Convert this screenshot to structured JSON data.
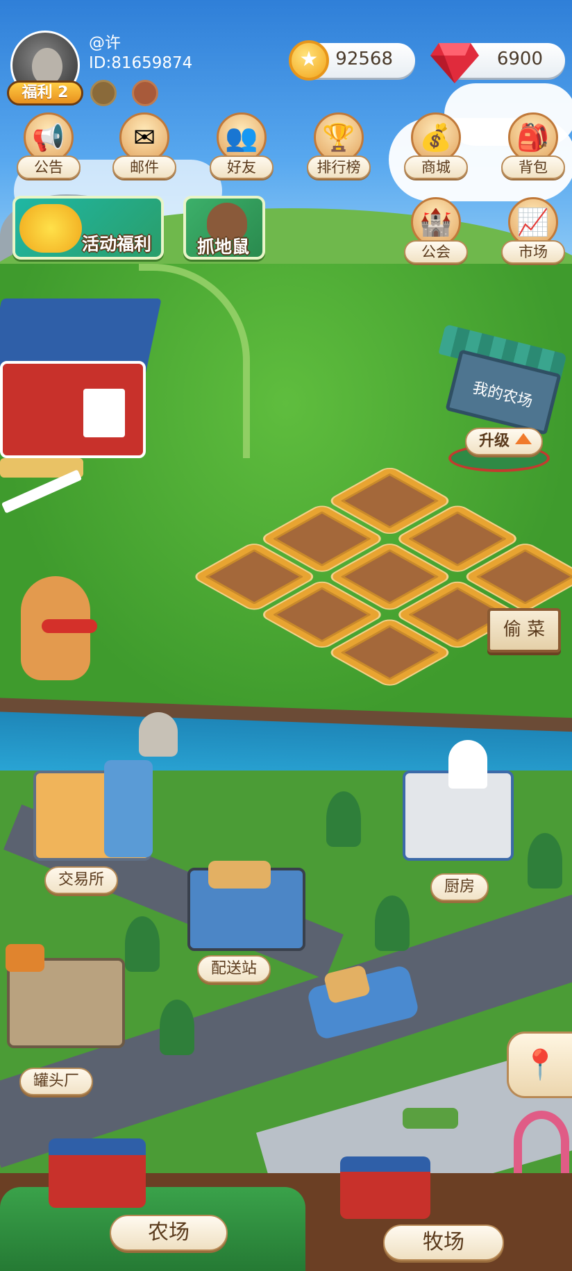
{
  "user": {
    "username": "@许",
    "id_text": "ID:81659874",
    "welfare_label": "福利 2"
  },
  "currency": {
    "coins": "92568",
    "gems": "6900",
    "coin_icon": "star-coin-icon",
    "gem_icon": "ruby-gem-icon"
  },
  "menu_top": [
    {
      "label": "公告",
      "icon": "megaphone-icon",
      "glyph": "📢"
    },
    {
      "label": "邮件",
      "icon": "mail-icon",
      "glyph": "✉"
    },
    {
      "label": "好友",
      "icon": "friends-icon",
      "glyph": "👥"
    },
    {
      "label": "排行榜",
      "icon": "podium-icon",
      "glyph": "🏆"
    },
    {
      "label": "商城",
      "icon": "shop-icon",
      "glyph": "💰"
    },
    {
      "label": "背包",
      "icon": "backpack-icon",
      "glyph": "🎒"
    }
  ],
  "menu_second": [
    {
      "label": "公会",
      "icon": "castle-icon",
      "glyph": "🏰"
    },
    {
      "label": "市场",
      "icon": "market-icon",
      "glyph": "📈"
    }
  ],
  "events": {
    "activity_label": "活动福利",
    "mole_label": "抓地鼠"
  },
  "farm": {
    "sign_text": "我的农场",
    "upgrade_label": "升级",
    "steal_label": "偷 菜"
  },
  "town": {
    "exchange": "交易所",
    "kitchen": "厨房",
    "delivery": "配送站",
    "cannery": "罐头厂"
  },
  "bottom_tabs": {
    "farm": "农场",
    "ranch": "牧场"
  },
  "colors": {
    "accent": "#e8a431",
    "plot_soil": "#a4683a",
    "grass": "#4aa63a"
  }
}
